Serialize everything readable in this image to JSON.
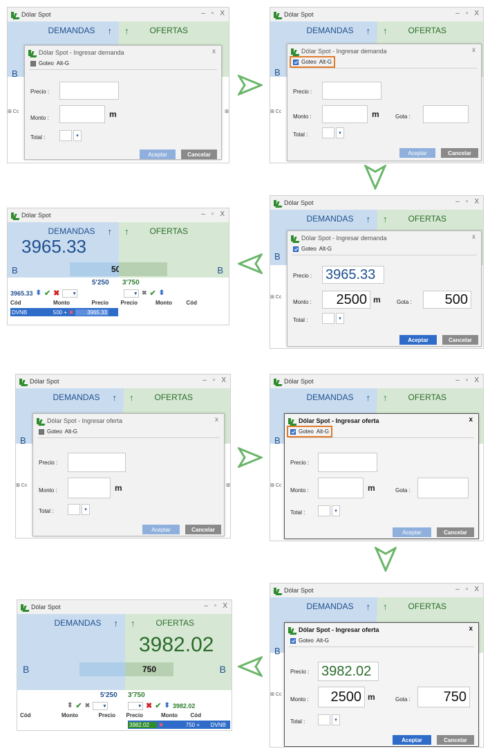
{
  "app_title": "Dólar Spot",
  "header": {
    "demandas": "DEMANDAS",
    "ofertas": "OFERTAS",
    "arrow_up": "↑"
  },
  "win_ctrls": {
    "minimize": "–",
    "maximize": "▫",
    "close": "X"
  },
  "dialog": {
    "title_demanda": "Dólar Spot - Ingresar demanda",
    "title_oferta": "Dólar Spot - Ingresar oferta",
    "close": "x",
    "goteo_label": "Goteo",
    "goteo_shortcut": "Alt-G",
    "precio_label": "Precio :",
    "monto_label": "Monto :",
    "monto_unit": "m",
    "gota_label": "Gota :",
    "total_label": "Total :",
    "aceptar": "Aceptar",
    "cancelar": "Cancelar",
    "dropdown_arrow": "▾"
  },
  "panels": {
    "dem_step3": {
      "precio": "3965.33",
      "monto": "2500",
      "gota": "500"
    },
    "ofe_step3": {
      "precio": "3982.02",
      "monto": "2500",
      "gota": "750"
    }
  },
  "result_demanda": {
    "big_price": "3965.33",
    "b_left": "B",
    "b_right": "B",
    "qty": "500",
    "sub_left": "5'250",
    "sub_right": "3'750",
    "ctrl_price": "3965.33",
    "cols": [
      "Cód",
      "Monto",
      "Precio",
      "Precio",
      "Monto",
      "Cód"
    ],
    "row": {
      "cod": "DVNB",
      "monto": "500 +",
      "precio": "3965.33"
    }
  },
  "result_oferta": {
    "big_price": "3982.02",
    "b_left": "B",
    "b_right": "B",
    "qty": "750",
    "sub_left": "5'250",
    "sub_right": "3'750",
    "ctrl_price": "3982.02",
    "cols": [
      "Cód",
      "Monto",
      "Precio",
      "Precio",
      "Monto",
      "Cód"
    ],
    "row": {
      "precio": "3982.02",
      "monto": "750 +",
      "cod": "DVNB"
    }
  },
  "strip": {
    "left": "⊞ Cc",
    "right": "⊞"
  },
  "colors": {
    "blue_bg": "#c9dcef",
    "green_bg": "#d6e8d3",
    "highlight": "#e07a2a",
    "accept": "#2f6cc9"
  }
}
